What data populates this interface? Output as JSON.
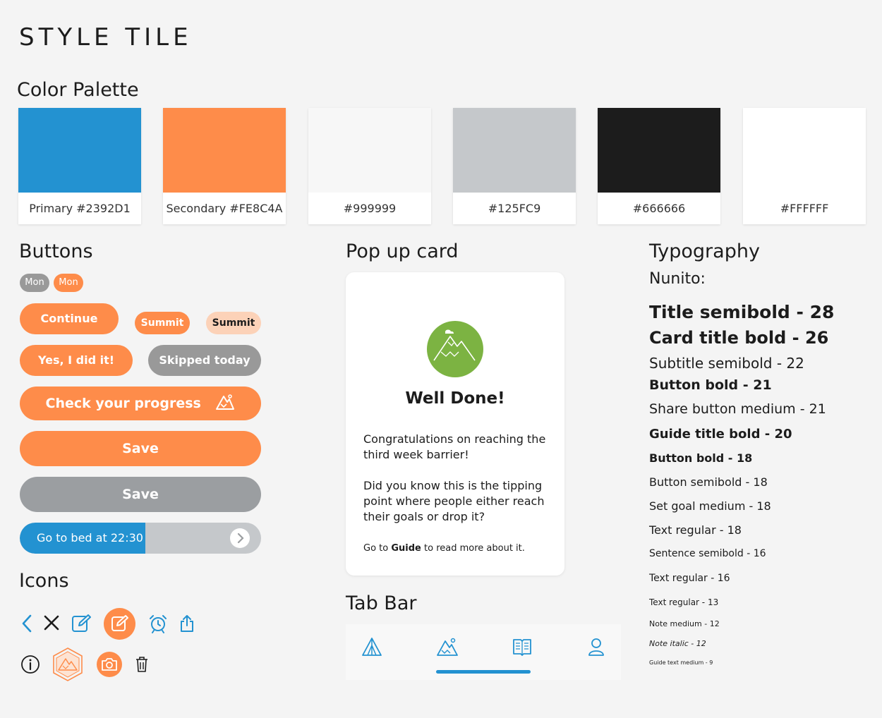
{
  "page_title": "STYLE TILE",
  "sections": {
    "color_palette": "Color Palette",
    "buttons": "Buttons",
    "icons": "Icons",
    "popup": "Pop up card",
    "tabbar": "Tab Bar",
    "typography": "Typography"
  },
  "palette": [
    {
      "label": "Primary #2392D1",
      "color": "#2392D1"
    },
    {
      "label": "Secondary #FE8C4A",
      "color": "#FE8C4A"
    },
    {
      "label": "#999999",
      "color": "#F7F7F7"
    },
    {
      "label": "#125FC9",
      "color": "#C5C8CB"
    },
    {
      "label": "#666666",
      "color": "#1C1C1C"
    },
    {
      "label": "#FFFFFF",
      "color": "#FFFFFF"
    }
  ],
  "buttons": {
    "pill_grey": "Mon",
    "pill_orange": "Mon",
    "continue": "Continue",
    "summit": "Summit",
    "summit_light": "Summit",
    "yes": "Yes, I did it!",
    "skipped": "Skipped today",
    "progress": "Check your progress",
    "save": "Save",
    "save_disabled": "Save",
    "slider": "Go to bed at 22:30"
  },
  "popup": {
    "heading": "Well Done!",
    "para1": "Congratulations on reaching the third week barrier!",
    "para2": "Did you know this is the tipping point where people either reach their goals or drop it?",
    "footer_pre": "Go to",
    "footer_link": "Guide",
    "footer_post": "to read more about it."
  },
  "typography": {
    "font": "Nunito:",
    "items": [
      "Title semibold - 28",
      "Card title bold - 26",
      "Subtitle semibold - 22",
      "Button bold - 21",
      "Share button medium - 21",
      "Guide title bold - 20",
      "Button bold - 18",
      "Button semibold - 18",
      "Set goal medium - 18",
      "Text regular - 18",
      "Sentence semibold - 16",
      "Text regular - 16",
      "Text regular - 13",
      "Note medium - 12",
      "Note italic - 12",
      "Guide text medium - 9"
    ]
  },
  "colors": {
    "primary": "#2392D1",
    "secondary": "#FE8C4A",
    "grey": "#999999",
    "success_green": "#7CB342"
  },
  "icons": [
    "chevron-left-icon",
    "close-icon",
    "edit-icon",
    "edit-circle-icon",
    "alarm-icon",
    "share-icon",
    "info-icon",
    "mountain-badge-icon",
    "camera-icon",
    "trash-icon"
  ],
  "tabbar_icons": [
    "tent-icon",
    "mountain-icon",
    "book-icon",
    "profile-icon"
  ]
}
